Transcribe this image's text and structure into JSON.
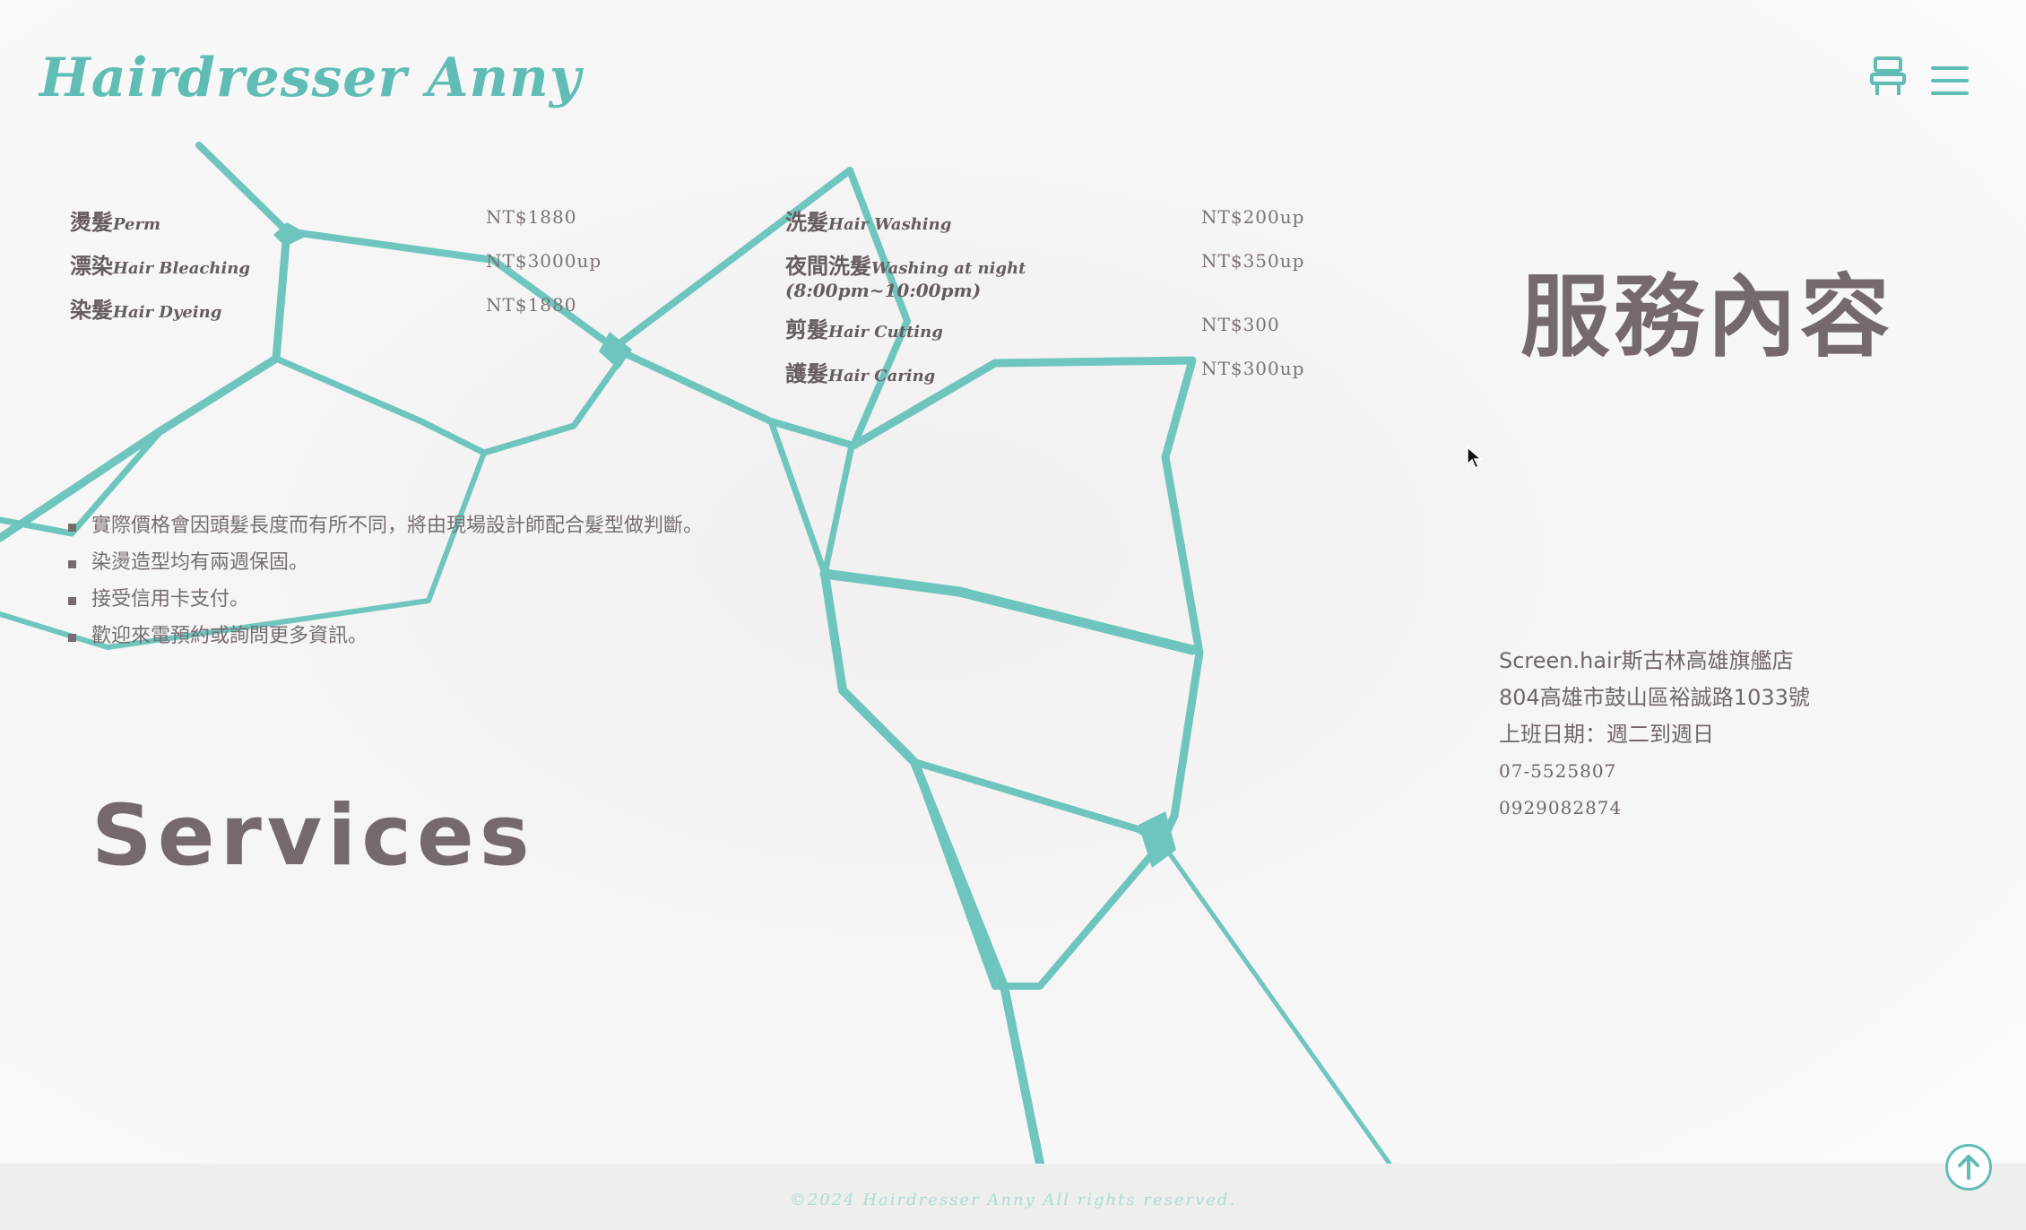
{
  "header": {
    "logo": "Hairdresser Anny",
    "icons": [
      "chair-icon",
      "menu-icon"
    ]
  },
  "prices_left": [
    {
      "zh": "燙髮",
      "en": "Perm",
      "price": "NT$1880"
    },
    {
      "zh": "漂染",
      "en": "Hair Bleaching",
      "price": "NT$3000up"
    },
    {
      "zh": "染髮",
      "en": "Hair Dyeing",
      "price": "NT$1880"
    }
  ],
  "prices_right": [
    {
      "zh": "洗髮",
      "en": "Hair Washing",
      "price": "NT$200up"
    },
    {
      "zh": "夜間洗髮",
      "en": "Washing at night",
      "price": "NT$350up",
      "note": "(8:00pm~10:00pm)"
    },
    {
      "zh": "剪髮",
      "en": "Hair Cutting",
      "price": "NT$300"
    },
    {
      "zh": "護髮",
      "en": "Hair Caring",
      "price": "NT$300up"
    }
  ],
  "title_zh": "服務內容",
  "title_en": "Services",
  "notes": [
    "實際價格會因頭髮長度而有所不同，將由現場設計師配合髮型做判斷。",
    "染燙造型均有兩週保固。",
    "接受信用卡支付。",
    "歡迎來電預約或詢問更多資訊。"
  ],
  "info": {
    "shop": "Screen.hair斯古林高雄旗艦店",
    "address": "804高雄市鼓山區裕誠路1033號",
    "hours": "上班日期：週二到週日",
    "phone1": "07-5525807",
    "phone2": "0929082874"
  },
  "footer": {
    "copyright": "©2024 Hairdresser Anny All rights reserved."
  },
  "colors": {
    "accent": "#5fbdb6",
    "text": "#74696d",
    "footer_bg": "#eeeeed"
  }
}
